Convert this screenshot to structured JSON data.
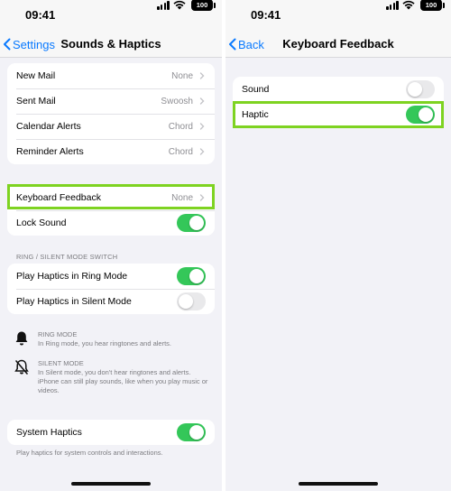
{
  "status_bar": {
    "time": "09:41",
    "battery": "100"
  },
  "left": {
    "nav": {
      "back": "Settings",
      "title": "Sounds & Haptics"
    },
    "alerts": [
      {
        "label": "New Mail",
        "value": "None"
      },
      {
        "label": "Sent Mail",
        "value": "Swoosh"
      },
      {
        "label": "Calendar Alerts",
        "value": "Chord"
      },
      {
        "label": "Reminder Alerts",
        "value": "Chord"
      }
    ],
    "keyboard_feedback": {
      "label": "Keyboard Feedback",
      "value": "None"
    },
    "lock_sound": {
      "label": "Lock Sound",
      "on": true
    },
    "ring_section_header": "RING / SILENT MODE SWITCH",
    "play_haptics_ring": {
      "label": "Play Haptics in Ring Mode",
      "on": true
    },
    "play_haptics_silent": {
      "label": "Play Haptics in Silent Mode",
      "on": false
    },
    "ring_mode": {
      "title": "RING MODE",
      "text": "In Ring mode, you hear ringtones and alerts."
    },
    "silent_mode": {
      "title": "SILENT MODE",
      "text": "In Silent mode, you don't hear ringtones and alerts. iPhone can still play sounds, like when you play music or videos."
    },
    "system_haptics": {
      "label": "System Haptics",
      "on": true
    },
    "system_haptics_footer": "Play haptics for system controls and interactions."
  },
  "right": {
    "nav": {
      "back": "Back",
      "title": "Keyboard Feedback"
    },
    "sound": {
      "label": "Sound",
      "on": false
    },
    "haptic": {
      "label": "Haptic",
      "on": true
    }
  },
  "colors": {
    "accent": "#0a7aff",
    "toggle_on": "#34c759",
    "highlight": "#7ed321",
    "background": "#f2f2f7"
  }
}
